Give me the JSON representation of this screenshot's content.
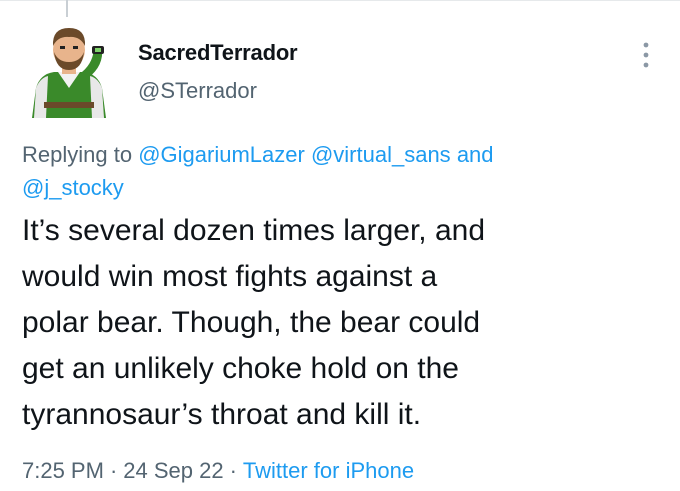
{
  "tweet": {
    "author": {
      "display_name": "SacredTerrador",
      "handle": "@STerrador",
      "avatar_icon": "cartoon-avatar-bearded-man-green-shirt"
    },
    "more_icon": "more-vertical-icon",
    "reply_context": {
      "prefix": "Replying to",
      "mentions": [
        "@GigariumLazer",
        "@virtual_sans",
        "@j_stocky"
      ],
      "conjunction": "and"
    },
    "text": "It’s several dozen times larger, and\nwould win most fights against a\npolar bear. Though, the bear could\nget an unlikely choke hold on the\ntyrannosaur’s throat and kill it.",
    "time": "7:25 PM",
    "date": "24 Sep 22",
    "separator": "·",
    "source": "Twitter for iPhone"
  },
  "colors": {
    "text_primary": "#0f1419",
    "text_secondary": "#536471",
    "link": "#1d9bf0",
    "avatar_shirt": "#3a8a2a"
  }
}
